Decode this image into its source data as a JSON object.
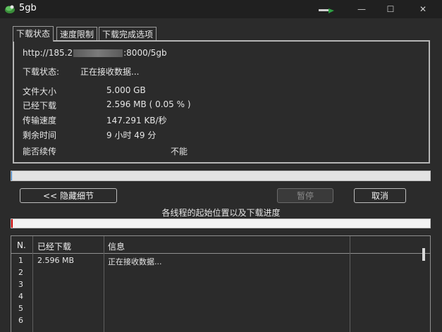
{
  "window": {
    "title": "5gb",
    "minimize_glyph": "—",
    "maximize_glyph": "☐",
    "close_glyph": "✕"
  },
  "tabs": [
    {
      "label": "下载状态"
    },
    {
      "label": "速度限制"
    },
    {
      "label": "下载完成选项"
    }
  ],
  "status_panel": {
    "url_prefix": "http://185.2",
    "url_suffix": ":8000/5gb",
    "status_label": "下载状态:",
    "status_value": "正在接收数据...",
    "file_size_label": "文件大小",
    "file_size_value": "5.000  GB",
    "downloaded_label": "已经下载",
    "downloaded_value": "2.596  MB  ( 0.05 % )",
    "speed_label": "传输速度",
    "speed_value": "147.291  KB/秒",
    "remaining_label": "剩余时间",
    "remaining_value": "9 小时 49 分",
    "resume_label": "能否续传",
    "resume_value": "不能"
  },
  "progress": {
    "percent": 0.05
  },
  "buttons": {
    "hide_details": "<< 隐藏细节",
    "pause": "暂停",
    "cancel": "取消"
  },
  "threads": {
    "caption": "各线程的起始位置以及下载进度",
    "columns": [
      "N.",
      "已经下载",
      "信息"
    ],
    "rows": [
      {
        "n": "1",
        "downloaded": "2.596 MB",
        "info": "正在接收数据..."
      },
      {
        "n": "2",
        "downloaded": "",
        "info": ""
      },
      {
        "n": "3",
        "downloaded": "",
        "info": ""
      },
      {
        "n": "4",
        "downloaded": "",
        "info": ""
      },
      {
        "n": "5",
        "downloaded": "",
        "info": ""
      },
      {
        "n": "6",
        "downloaded": "",
        "info": ""
      }
    ]
  },
  "colors": {
    "background": "#2b2b2b",
    "titlebar": "#202020",
    "thread_progress": "#d00000"
  }
}
